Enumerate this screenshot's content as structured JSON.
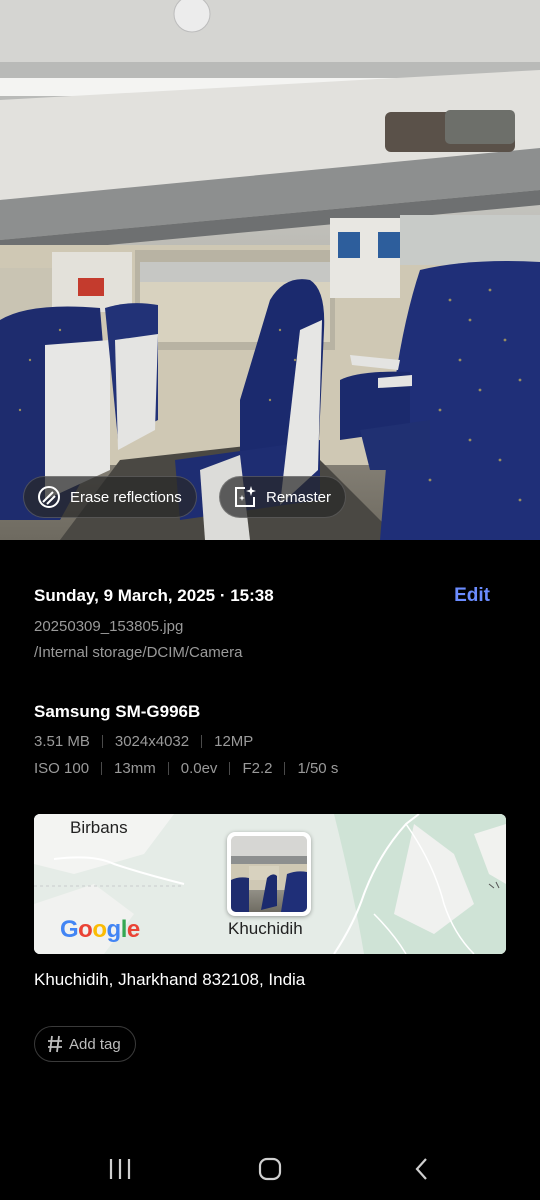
{
  "photo_actions": {
    "erase_label": "Erase reflections",
    "remaster_label": "Remaster"
  },
  "details": {
    "datetime": "Sunday, 9 March, 2025 · 15:38",
    "edit_label": "Edit",
    "filename": "20250309_153805.jpg",
    "path": "/Internal storage/DCIM/Camera",
    "device": "Samsung SM-G996B",
    "file_specs": [
      "3.51 MB",
      "3024x4032",
      "12MP"
    ],
    "camera_specs": [
      "ISO 100",
      "13mm",
      "0.0ev",
      "F2.2",
      "1/50 s"
    ]
  },
  "map": {
    "place_label_top": "Birbans",
    "pin_label": "Khuchidih",
    "attribution": "Google"
  },
  "address": "Khuchidih, Jharkhand 832108, India",
  "tag_label": "Add tag",
  "colors": {
    "accent": "#6b8cff",
    "background": "#000000",
    "secondary_text": "#9a9a9a"
  },
  "icons": {
    "erase": "erase-reflections-icon",
    "remaster": "remaster-icon",
    "tag": "hash-icon",
    "nav": [
      "recents-icon",
      "home-icon",
      "back-icon"
    ]
  }
}
